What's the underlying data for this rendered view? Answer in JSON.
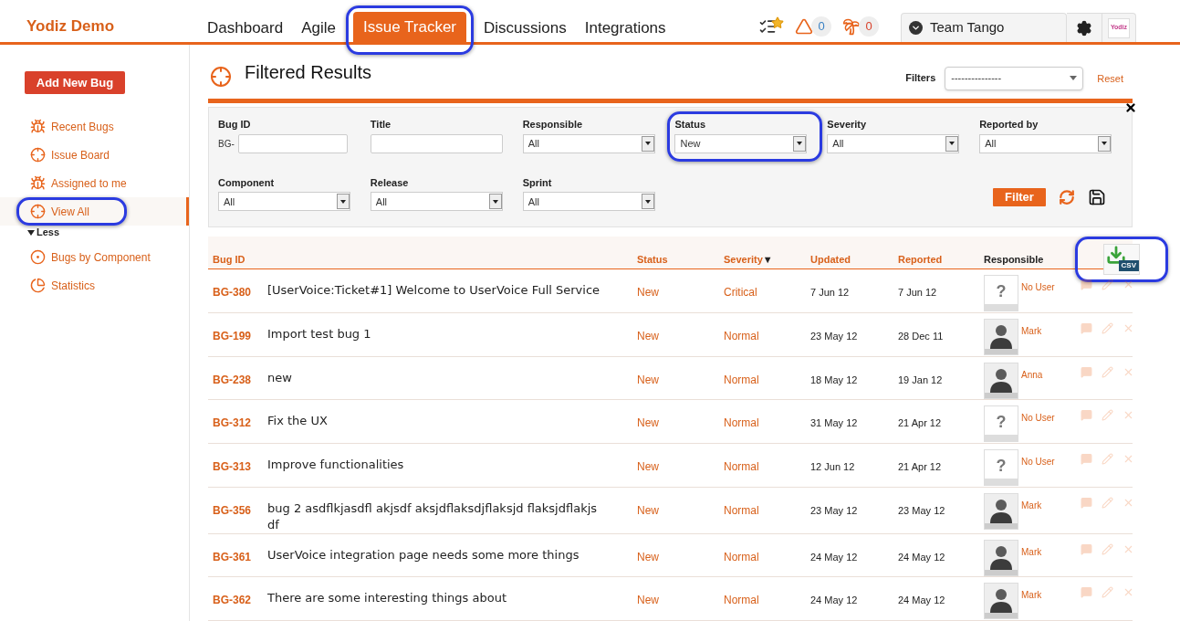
{
  "app_name": "Yodiz Demo",
  "nav_tabs": [
    {
      "label": "Dashboard",
      "selected": false,
      "highlighted": false
    },
    {
      "label": "Agile",
      "selected": false,
      "highlighted": false
    },
    {
      "label": "Issue Tracker",
      "selected": true,
      "highlighted": true
    },
    {
      "label": "Discussions",
      "selected": false,
      "highlighted": false
    },
    {
      "label": "Integrations",
      "selected": false,
      "highlighted": false
    }
  ],
  "counters": [
    {
      "value": "0",
      "color": "#3b82c4"
    },
    {
      "value": "0",
      "color": "#d9412b"
    }
  ],
  "team": "Team Tango",
  "logo_text": "Yodiz",
  "sidebar": {
    "add_button": "Add New Bug",
    "items": [
      {
        "label": "Recent Bugs",
        "selected": false,
        "highlighted": false
      },
      {
        "label": "Issue Board",
        "selected": false,
        "highlighted": false
      },
      {
        "label": "Assigned to me",
        "selected": false,
        "highlighted": false
      },
      {
        "label": "View All",
        "selected": true,
        "highlighted": true
      }
    ],
    "toggle": "Less",
    "more_items": [
      {
        "label": "Bugs by Component"
      },
      {
        "label": "Statistics"
      }
    ]
  },
  "page_title": "Filtered Results",
  "filters_label": "Filters",
  "filters_select": "---------------",
  "reset": "Reset",
  "filter_fields": [
    {
      "label": "Bug ID",
      "kind": "text",
      "prefix": "BG-",
      "highlighted": false
    },
    {
      "label": "Title",
      "kind": "text",
      "highlighted": false
    },
    {
      "label": "Responsible",
      "kind": "select",
      "value": "All",
      "highlighted": false
    },
    {
      "label": "Status",
      "kind": "select",
      "value": "New",
      "highlighted": true
    },
    {
      "label": "Severity",
      "kind": "select",
      "value": "All",
      "highlighted": false
    },
    {
      "label": "Reported by",
      "kind": "select",
      "value": "All",
      "highlighted": false
    },
    {
      "label": "Component",
      "kind": "select",
      "value": "All",
      "highlighted": false
    },
    {
      "label": "Release",
      "kind": "select",
      "value": "All",
      "highlighted": false
    },
    {
      "label": "Sprint",
      "kind": "select",
      "value": "All",
      "highlighted": false
    }
  ],
  "filter_button": "Filter",
  "csv": {
    "label": "CSV",
    "highlighted": true
  },
  "columns": [
    {
      "label": "Bug ID",
      "sortable": true,
      "sorted": false
    },
    {
      "label": "Status",
      "sortable": true,
      "sorted": false
    },
    {
      "label": "Severity",
      "sortable": true,
      "sorted": true
    },
    {
      "label": "Updated",
      "sortable": true,
      "sorted": false
    },
    {
      "label": "Reported",
      "sortable": true,
      "sorted": false
    },
    {
      "label": "Responsible",
      "sortable": false,
      "sorted": false
    }
  ],
  "sort_mark": "▼",
  "rows": [
    {
      "id": "BG-380",
      "title": "[UserVoice:Ticket#1] Welcome to UserVoice Full Service",
      "status": "New",
      "severity": "Critical",
      "updated": "7 Jun 12",
      "reported": "7 Jun 12",
      "responsible": {
        "name": "No User",
        "kind": "none",
        "mark": "?"
      }
    },
    {
      "id": "BG-199",
      "title": "Import test bug 1",
      "status": "New",
      "severity": "Normal",
      "updated": "23 May 12",
      "reported": "28 Dec 11",
      "responsible": {
        "name": "Mark",
        "kind": "user"
      }
    },
    {
      "id": "BG-238",
      "title": "new",
      "status": "New",
      "severity": "Normal",
      "updated": "18 May 12",
      "reported": "19 Jan 12",
      "responsible": {
        "name": "Anna",
        "kind": "user"
      }
    },
    {
      "id": "BG-312",
      "title": "Fix the UX",
      "status": "New",
      "severity": "Normal",
      "updated": "31 May 12",
      "reported": "21 Apr 12",
      "responsible": {
        "name": "No User",
        "kind": "none",
        "mark": "?"
      }
    },
    {
      "id": "BG-313",
      "title": "Improve functionalities",
      "status": "New",
      "severity": "Normal",
      "updated": "12 Jun 12",
      "reported": "21 Apr 12",
      "responsible": {
        "name": "No User",
        "kind": "none",
        "mark": "?"
      }
    },
    {
      "id": "BG-356",
      "title": "bug 2 asdflkjasdfl akjsdf aksjdflaksdjflaksjd flaksjdflakjs df",
      "status": "New",
      "severity": "Normal",
      "updated": "23 May 12",
      "reported": "23 May 12",
      "responsible": {
        "name": "Mark",
        "kind": "user"
      }
    },
    {
      "id": "BG-361",
      "title": "UserVoice integration page needs some more things",
      "status": "New",
      "severity": "Normal",
      "updated": "24 May 12",
      "reported": "24 May 12",
      "responsible": {
        "name": "Mark",
        "kind": "user"
      }
    },
    {
      "id": "BG-362",
      "title": "There are some interesting things about",
      "status": "New",
      "severity": "Normal",
      "updated": "24 May 12",
      "reported": "24 May 12",
      "responsible": {
        "name": "Mark",
        "kind": "user"
      }
    }
  ]
}
